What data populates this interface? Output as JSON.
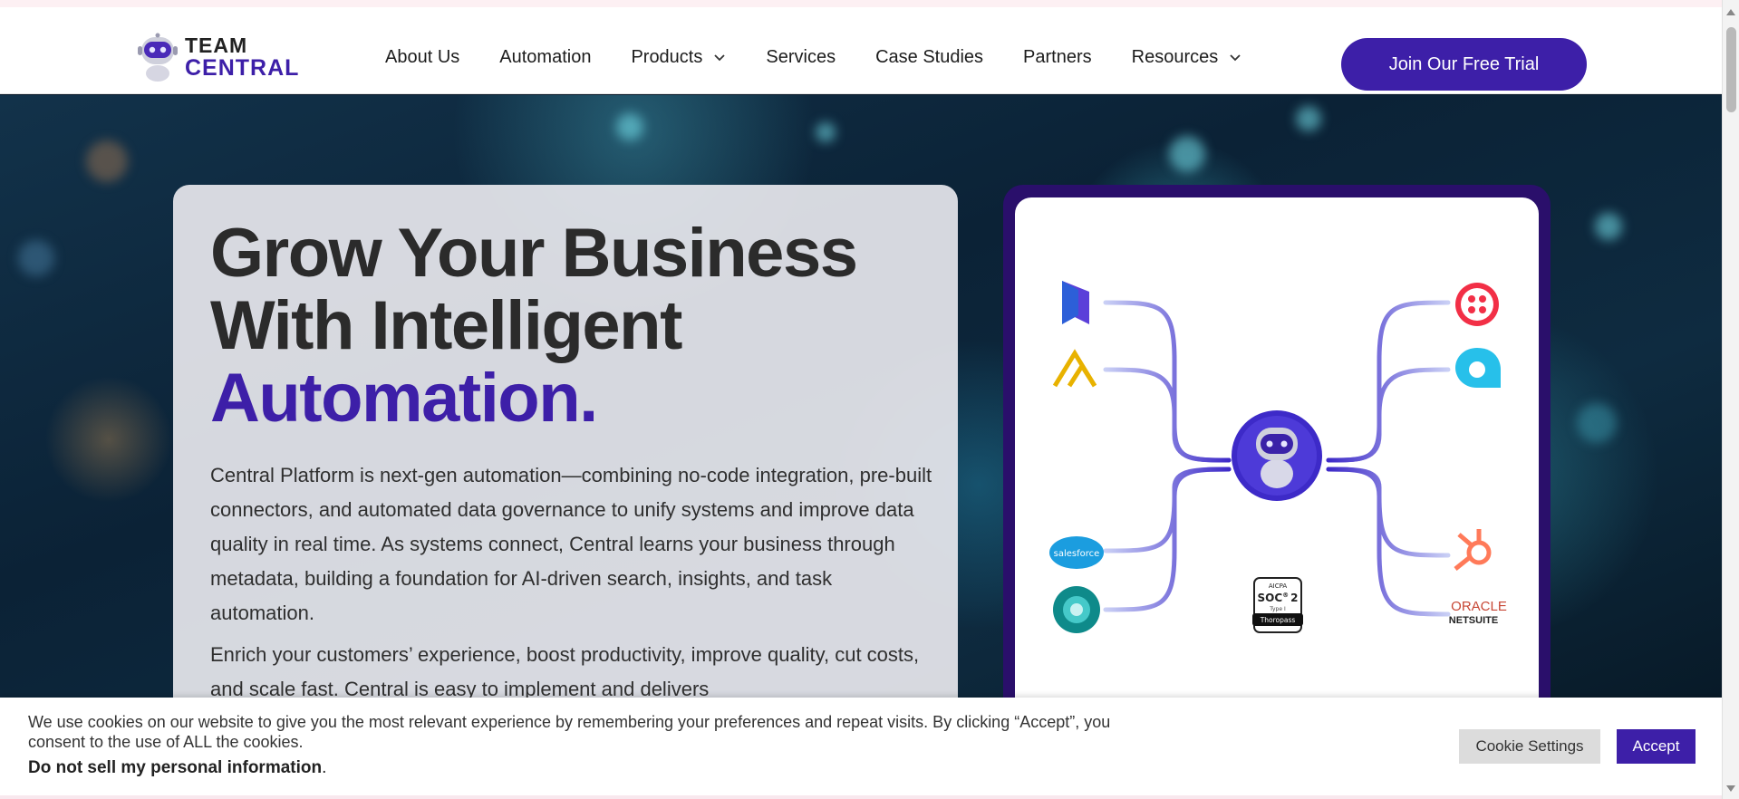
{
  "header": {
    "logo": {
      "line1": "TEAM",
      "line2": "CENTRAL"
    },
    "nav": [
      {
        "label": "About Us",
        "has_dropdown": false
      },
      {
        "label": "Automation",
        "has_dropdown": false
      },
      {
        "label": "Products",
        "has_dropdown": true
      },
      {
        "label": "Services",
        "has_dropdown": false
      },
      {
        "label": "Case Studies",
        "has_dropdown": false
      },
      {
        "label": "Partners",
        "has_dropdown": false
      },
      {
        "label": "Resources",
        "has_dropdown": true
      }
    ],
    "cta_label": "Join Our Free Trial"
  },
  "hero": {
    "title_line1": "Grow Your Business",
    "title_line2": "With Intelligent",
    "title_accent": "Automation.",
    "paragraph1": "Central Platform is next-gen automation—combining no-code integration, pre-built connectors, and automated data governance to unify systems and improve data quality in real time. As systems connect, Central learns your business through metadata, building a foundation for AI-driven search, insights, and task automation.",
    "paragraph2": "Enrich your customers’ experience, boost productivity, improve quality, cut costs, and scale fast. Central is easy to implement and delivers"
  },
  "integrations": {
    "left": [
      "dynamics-icon",
      "archer-icon",
      "salesforce-icon",
      "business-central-icon"
    ],
    "right": [
      "twilio-icon",
      "chat-bubble-icon",
      "hubspot-icon",
      "oracle-netsuite-icon"
    ],
    "salesforce_label": "salesforce",
    "oracle_label": "ORACLE",
    "netsuite_label": "NETSUITE",
    "badge": {
      "line1": "AICPA",
      "line2": "SOC",
      "sup": "®",
      "num": "2",
      "line3": "Type I",
      "line4": "Thoropass"
    }
  },
  "cookie": {
    "text": "We use cookies on our website to give you the most relevant experience by remembering your preferences and repeat visits. By clicking “Accept”, you consent to the use of ALL the cookies.",
    "dns_link": "Do not sell my personal information",
    "dns_suffix": ".",
    "settings_label": "Cookie Settings",
    "accept_label": "Accept"
  },
  "colors": {
    "brand": "#3d1fa8",
    "brand_dark": "#2a0f6b"
  }
}
